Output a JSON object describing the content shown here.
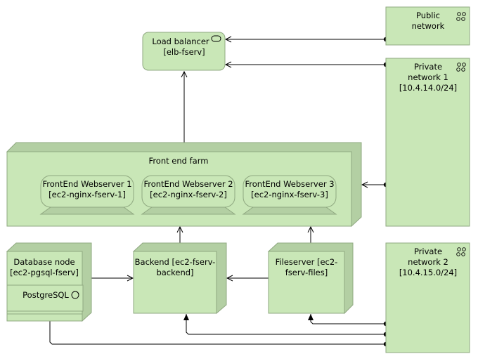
{
  "colors": {
    "node_fill": "#c9e7b7",
    "node_side": "#b3cfa3",
    "border": "#8fa880"
  },
  "load_balancer": {
    "name": "Load balancer",
    "id": "[elb-fserv]",
    "icon": "interface-pill-icon"
  },
  "public_network": {
    "line1": "Public",
    "line2": "network",
    "icon": "network-icon"
  },
  "private_network_1": {
    "line1": "Private",
    "line2": "network 1",
    "line3": "[10.4.14.0/24]",
    "icon": "network-icon"
  },
  "private_network_2": {
    "line1": "Private",
    "line2": "network 2",
    "line3": "[10.4.15.0/24]",
    "icon": "network-icon"
  },
  "frontend_farm": {
    "name": "Front end farm",
    "webservers": [
      {
        "line1": "FrontEnd Webserver 1",
        "line2": "[ec2-nginx-fserv-1]"
      },
      {
        "line1": "FrontEnd Webserver 2",
        "line2": "[ec2-nginx-fserv-2]"
      },
      {
        "line1": "FrontEnd Webserver 3",
        "line2": "[ec2-nginx-fserv-3]"
      }
    ]
  },
  "database_node": {
    "line1": "Database node",
    "line2": "[ec2-pgsql-fserv]",
    "software": "PostgreSQL",
    "software_icon": "system-software-icon"
  },
  "backend": {
    "line1": "Backend [ec2-fserv-",
    "line2": "backend]"
  },
  "fileserver": {
    "line1": "Fileserver [ec2-",
    "line2": "fserv-files]"
  }
}
